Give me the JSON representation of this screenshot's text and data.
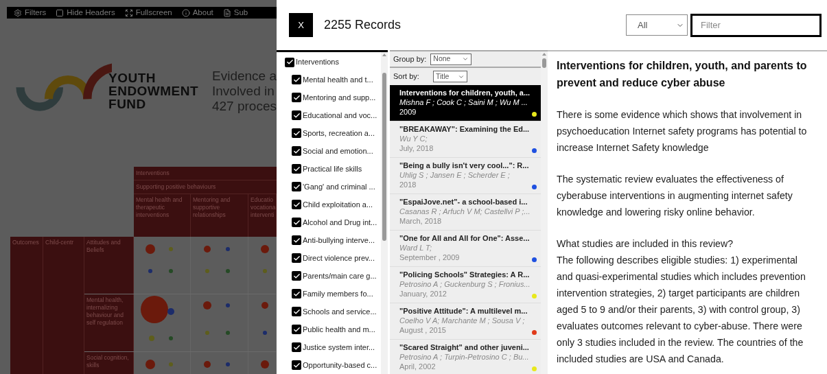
{
  "background": {
    "toolbar": [
      {
        "label": "Filters",
        "kind": "gear"
      },
      {
        "label": "Hide Headers",
        "kind": "square"
      },
      {
        "label": "Fullscreen",
        "kind": "expand"
      },
      {
        "label": "About",
        "kind": "info"
      },
      {
        "label": "Sub",
        "kind": "file"
      }
    ],
    "logo": [
      "YOUTH",
      "ENDOWMENT",
      "FUND"
    ],
    "intro": [
      "Evidence a",
      "Involved in",
      "427 proces"
    ],
    "table": {
      "header_rows": [
        "Interventions",
        "Supporting positive behaviours"
      ],
      "columns": [
        "Mental health and therapeutic interventions",
        "Mentoring and supportive relationships",
        "Educatio vocationa interventi"
      ],
      "outcome_group": "Outcomes",
      "sub_group": "Child-centr",
      "rows": [
        "Attitudes and Beliefs",
        "Mental health, internalizing behaviour and self regulation",
        "Social cognition, skills"
      ]
    }
  },
  "dialog": {
    "close": "X",
    "count": "2255 Records",
    "scope": "All",
    "filter": {
      "placeholder": "Filter"
    },
    "tree": [
      {
        "label": "Interventions",
        "checked": true,
        "children": [
          {
            "label": "Mental health and t...",
            "checked": true
          },
          {
            "label": "Mentoring and supp...",
            "checked": true
          },
          {
            "label": "Educational and voc...",
            "checked": true
          },
          {
            "label": "Sports, recreation a...",
            "checked": true
          },
          {
            "label": "Social and emotion...",
            "checked": true
          },
          {
            "label": "Practical life skills",
            "checked": true
          },
          {
            "label": "'Gang' and criminal ...",
            "checked": true
          },
          {
            "label": "Child exploitation a...",
            "checked": true
          },
          {
            "label": "Alcohol and Drug int...",
            "checked": true
          },
          {
            "label": "Anti-bullying interve...",
            "checked": true
          },
          {
            "label": "Direct violence prev...",
            "checked": true
          },
          {
            "label": "Parents/main care g...",
            "checked": true
          },
          {
            "label": "Family members fo...",
            "checked": true
          },
          {
            "label": "Schools and service...",
            "checked": true
          },
          {
            "label": "Public health and m...",
            "checked": true
          },
          {
            "label": "Justice system inter...",
            "checked": true
          },
          {
            "label": "Opportunity-based c...",
            "checked": true
          }
        ]
      }
    ],
    "group_by": {
      "label": "Group by:",
      "value": "None"
    },
    "sort_by": {
      "label": "Sort by:",
      "value": "Title"
    },
    "records": [
      {
        "title": "Interventions for children, youth, a...",
        "authors": "Mishna F ; Cook C ; Saini M ; Wu M ...",
        "date": "2009",
        "color": "#e8e81c",
        "selected": true
      },
      {
        "title": "\"BREAKAWAY\": Examining the Ed...",
        "authors": "Wu Y C;",
        "date": "July, 2018",
        "color": "#1f50e0",
        "selected": false
      },
      {
        "title": "\"Being a bully isn't very cool...\": R...",
        "authors": "Uhlig S ; Jansen E ; Scherder E ;",
        "date": "2018",
        "color": "#1f50e0",
        "selected": false
      },
      {
        "title": "\"EspaiJove.net\"- a school-based i...",
        "authors": "Casanas R ; Arfuch V M; Castellvi P ;...",
        "date": "March, 2018",
        "selected": false
      },
      {
        "title": "\"One for All and All for One\": Asse...",
        "authors": "Ward L T;",
        "date": "September , 2009",
        "color": "#1f50e0",
        "selected": false
      },
      {
        "title": "\"Policing Schools\" Strategies: A R...",
        "authors": "Petrosino A ; Guckenburg S ; Fronius...",
        "date": "January, 2012",
        "color": "#e8e81c",
        "selected": false
      },
      {
        "title": "\"Positive Attitude\": A multilevel m...",
        "authors": "Coelho V A; Marchante M ; Sousa V ;",
        "date": "August , 2015",
        "color": "#e03a1a",
        "selected": false
      },
      {
        "title": "\"Scared Straight\" and other juveni...",
        "authors": "Petrosino A ; Turpin-Petrosino C ; Bu...",
        "date": "April, 2002",
        "color": "#e8e81c",
        "selected": false
      }
    ],
    "detail": {
      "title": "Interventions for children, youth, and parents to prevent and reduce cyber abuse",
      "paragraphs": [
        "There is some evidence which shows that involvement in psychoeducation Internet safety programs has potential to increase Internet Safety knowledge",
        "The systematic review evaluates the effectiveness of cyberabuse interventions in augmenting internet safety knowledge and lowering risky online behavior.",
        "What studies are included in this review?\nThe following describes eligible studies: 1) experimental and quasi-experimental studies which includes prevention intervention strategies, 2) target participants are children aged 5 to 9 and/or their parents, 3) with control group, 3) evaluates outcomes relevant to cyber-abuse. There were only 3 studies included in the review. The countries of the included studies are USA and Canada."
      ]
    }
  }
}
